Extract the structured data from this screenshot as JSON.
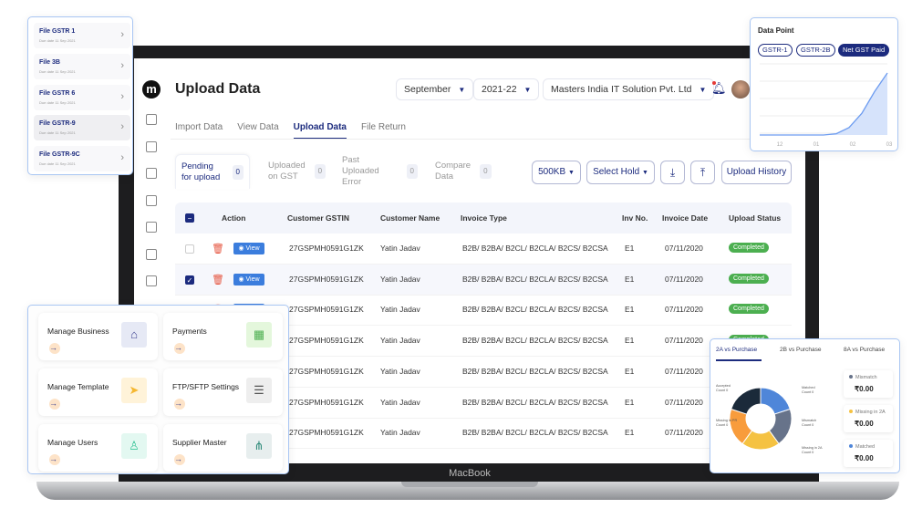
{
  "laptop": {
    "brand": "MacBook"
  },
  "app": {
    "logo": "m",
    "title": "Upload Data",
    "month": "September",
    "year": "2021-22",
    "company": "Masters India IT Solution Pvt. Ltd",
    "sidebar_icons": [
      "calendar-icon",
      "grid-icon",
      "box-icon",
      "file-icon",
      "report-icon",
      "cube-icon",
      "network-icon"
    ],
    "tabs": [
      "Import Data",
      "View Data",
      "Upload Data",
      "File Return"
    ],
    "active_tab": "Upload Data",
    "subtabs": [
      {
        "label": "Pending for upload",
        "count": "0"
      },
      {
        "label": "Uploaded on GST",
        "count": "0"
      },
      {
        "label": "Past Uploaded Error",
        "count": "0"
      },
      {
        "label": "Compare Data",
        "count": "0"
      }
    ],
    "toolbar": {
      "size": "500KB",
      "hold": "Select Hold",
      "history": "Upload History"
    },
    "columns": [
      "Action",
      "Customer GSTIN",
      "Customer Name",
      "Invoice Type",
      "Inv No.",
      "Invoice Date",
      "Upload Status"
    ],
    "view_label": "View",
    "rows": [
      {
        "gstin": "27GSPMH0591G1ZK",
        "name": "Yatin Jadav",
        "type": "B2B/ B2BA/ B2CL/ B2CLA/ B2CS/ B2CSA",
        "inv": "E1",
        "date": "07/11/2020",
        "status": "Completed",
        "checked": false
      },
      {
        "gstin": "27GSPMH0591G1ZK",
        "name": "Yatin Jadav",
        "type": "B2B/ B2BA/ B2CL/ B2CLA/ B2CS/ B2CSA",
        "inv": "E1",
        "date": "07/11/2020",
        "status": "Completed",
        "checked": true
      },
      {
        "gstin": "27GSPMH0591G1ZK",
        "name": "Yatin Jadav",
        "type": "B2B/ B2BA/ B2CL/ B2CLA/ B2CS/ B2CSA",
        "inv": "E1",
        "date": "07/11/2020",
        "status": "Completed",
        "checked": false
      },
      {
        "gstin": "27GSPMH0591G1ZK",
        "name": "Yatin Jadav",
        "type": "B2B/ B2BA/ B2CL/ B2CLA/ B2CS/ B2CSA",
        "inv": "E1",
        "date": "07/11/2020",
        "status": "Completed",
        "checked": false
      },
      {
        "gstin": "27GSPMH0591G1ZK",
        "name": "Yatin Jadav",
        "type": "B2B/ B2BA/ B2CL/ B2CLA/ B2CS/ B2CSA",
        "inv": "E1",
        "date": "07/11/2020",
        "status": "Completed",
        "checked": false
      },
      {
        "gstin": "27GSPMH0591G1ZK",
        "name": "Yatin Jadav",
        "type": "B2B/ B2BA/ B2CL/ B2CLA/ B2CS/ B2CSA",
        "inv": "E1",
        "date": "07/11/2020",
        "status": "Completed",
        "checked": false
      },
      {
        "gstin": "27GSPMH0591G1ZK",
        "name": "Yatin Jadav",
        "type": "B2B/ B2BA/ B2CL/ B2CLA/ B2CS/ B2CSA",
        "inv": "E1",
        "date": "07/11/2020",
        "status": "Completed",
        "checked": false
      }
    ]
  },
  "gst_card": {
    "items": [
      {
        "name": "File GSTR 1",
        "due": "Due date 11 Sep 2021"
      },
      {
        "name": "File 3B",
        "due": "Due date 11 Sep 2021"
      },
      {
        "name": "File GSTR 6",
        "due": "Due date 11 Sep 2021"
      },
      {
        "name": "File GSTR-9",
        "due": "Due date 11 Sep 2021"
      },
      {
        "name": "File GSTR-9C",
        "due": "Due date 11 Sep 2021"
      }
    ]
  },
  "data_point": {
    "title": "Data Point",
    "pills": [
      "GSTR-1",
      "GSTR-2B",
      "Net GST Paid"
    ],
    "active": "Net GST Paid",
    "x_ticks": [
      "12",
      "01",
      "02",
      "03"
    ],
    "series": [
      0,
      0,
      0,
      0,
      0,
      0,
      0.02,
      0.12,
      0.35,
      0.7,
      1
    ]
  },
  "settings_card": {
    "tiles": [
      {
        "name": "Manage Business",
        "icon": "building-icon",
        "bg": "#e6e9f5",
        "fg": "#3a3f8f"
      },
      {
        "name": "Payments",
        "icon": "qr-icon",
        "bg": "#e4f7dc",
        "fg": "#4caf50"
      },
      {
        "name": "Manage Template",
        "icon": "send-icon",
        "bg": "#fff3d9",
        "fg": "#f5b731"
      },
      {
        "name": "FTP/SFTP Settings",
        "icon": "server-icon",
        "bg": "#eeeeee",
        "fg": "#555"
      },
      {
        "name": "Manage Users",
        "icon": "user-icon",
        "bg": "#e3f8f1",
        "fg": "#3cc59a"
      },
      {
        "name": "Supplier Master",
        "icon": "hierarchy-icon",
        "bg": "#e7eeee",
        "fg": "#2e8b7a"
      }
    ]
  },
  "recon": {
    "tabs": [
      "2A vs Purchase",
      "2B vs Purchase",
      "8A vs Purchase"
    ],
    "active": "2A vs Purchase",
    "slices": [
      {
        "label": "Matched",
        "count": "Count 0",
        "color": "#4f86d9",
        "share": 20
      },
      {
        "label": "Mismatch",
        "count": "Count 0",
        "color": "#67738a",
        "share": 20
      },
      {
        "label": "Missing in 2A",
        "count": "Count 0",
        "color": "#f5c242",
        "share": 20
      },
      {
        "label": "Missing in PR",
        "count": "Count 0",
        "color": "#f89c3c",
        "share": 20
      },
      {
        "label": "Accepted",
        "count": "Count 0",
        "color": "#1b2a3a",
        "share": 20
      }
    ],
    "stats": [
      {
        "label": "Mismatch",
        "value": "₹0.00",
        "color": "#67738a"
      },
      {
        "label": "Missing in 2A",
        "value": "₹0.00",
        "color": "#f5c242"
      },
      {
        "label": "Matched",
        "value": "₹0.00",
        "color": "#4f86d9"
      }
    ]
  },
  "colors": {
    "brand": "#1c2b7e",
    "completed": "#4caf50",
    "view": "#3b7ddd",
    "delete": "#e5533d"
  }
}
